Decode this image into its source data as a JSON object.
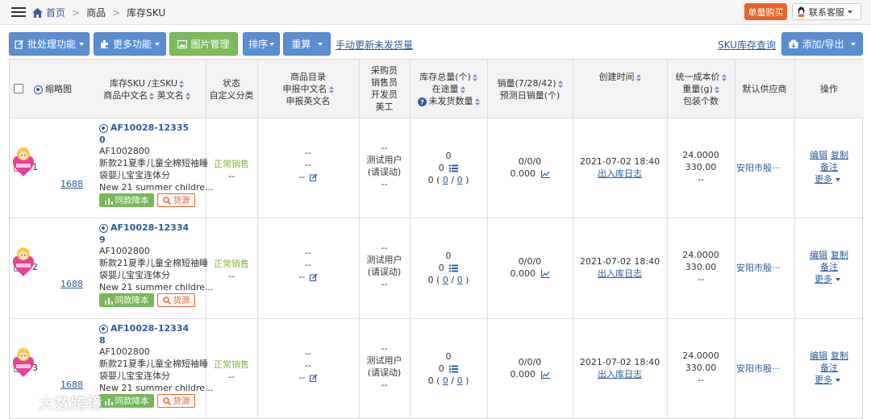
{
  "breadcrumb": {
    "home": "首页",
    "level2": "商品",
    "level3": "库存SKU"
  },
  "header": {
    "buy_button": "单量购买",
    "service_label": "联系客服"
  },
  "toolbar": {
    "batch": "批处理功能",
    "more": "更多功能",
    "image_manage": "图片管理",
    "sort": "排序",
    "recalc": "重算",
    "manual_update": "手动更新未发货量",
    "sku_query": "SKU库存查询",
    "add_export": "添加/导出"
  },
  "columns": {
    "thumb": "缩略图",
    "sku_l1": "库存SKU /主SKU",
    "sku_l2": "商品中文名",
    "sku_l3": "英文名",
    "status_l1": "状态",
    "status_l2": "自定义分类",
    "catalog_l1": "商品目录",
    "catalog_l2": "申报中文名",
    "catalog_l3": "申报英文名",
    "staff_l1": "采购员",
    "staff_l2": "销售员",
    "staff_l3": "开发员",
    "staff_l4": "美工",
    "stock_l1": "库存总量(个)",
    "stock_l2": "在途量",
    "stock_l3": "未发货数量",
    "sales_l1": "销量(7/28/42)",
    "sales_l2": "预测日销量(个)",
    "created": "创建时间",
    "cost_l1": "统一成本价",
    "cost_l2": "重量(g)",
    "cost_l3": "包装个数",
    "supplier": "默认供应商",
    "ops": "操作"
  },
  "rows": [
    {
      "index": "1",
      "sku_a": "AF10028-12335",
      "sku_b": "0",
      "main_sku": "AF1002800",
      "name_cn_1": "新款21夏季儿童全棉短袖睡",
      "name_cn_2": "袋婴儿宝宝连体分",
      "name_en": "New 21 summer childre...",
      "thumb_link": "1688",
      "status": "正常销售",
      "category": "--",
      "catalog": "--",
      "declare_cn": "--",
      "declare_en": "--",
      "buyer": "--",
      "seller_1": "测试用户",
      "seller_2": "(请误动)",
      "dev": "--",
      "stock": "0",
      "in_transit": "0",
      "unshipped_a": "0",
      "unshipped_b": "0",
      "unshipped_c": "0",
      "sales": "0/0/0",
      "forecast": "0.000",
      "created": "2021-07-02 18:40",
      "log_link": "出入库日志",
      "cost": "24.0000",
      "weight": "330.00",
      "pack": "--",
      "supplier": "安阳市殷···",
      "op_edit": "编辑",
      "op_copy": "复制",
      "op_note": "备注",
      "op_more": "更多"
    },
    {
      "index": "2",
      "sku_a": "AF10028-12334",
      "sku_b": "9",
      "main_sku": "AF1002800",
      "name_cn_1": "新款21夏季儿童全棉短袖睡",
      "name_cn_2": "袋婴儿宝宝连体分",
      "name_en": "New 21 summer childre...",
      "thumb_link": "1688",
      "status": "正常销售",
      "category": "--",
      "catalog": "--",
      "declare_cn": "--",
      "declare_en": "--",
      "buyer": "--",
      "seller_1": "测试用户",
      "seller_2": "(请误动)",
      "dev": "--",
      "stock": "0",
      "in_transit": "0",
      "unshipped_a": "0",
      "unshipped_b": "0",
      "unshipped_c": "0",
      "sales": "0/0/0",
      "forecast": "0.000",
      "created": "2021-07-02 18:40",
      "log_link": "出入库日志",
      "cost": "24.0000",
      "weight": "330.00",
      "pack": "--",
      "supplier": "安阳市殷···",
      "op_edit": "编辑",
      "op_copy": "复制",
      "op_note": "备注",
      "op_more": "更多"
    },
    {
      "index": "3",
      "sku_a": "AF10028-12334",
      "sku_b": "8",
      "main_sku": "AF1002800",
      "name_cn_1": "新款21夏季儿童全棉短袖睡",
      "name_cn_2": "袋婴儿宝宝连体分",
      "name_en": "New 21 summer childre...",
      "thumb_link": "1688",
      "status": "正常销售",
      "category": "--",
      "catalog": "--",
      "declare_cn": "--",
      "declare_en": "--",
      "buyer": "--",
      "seller_1": "测试用户",
      "seller_2": "(请误动)",
      "dev": "--",
      "stock": "0",
      "in_transit": "0",
      "unshipped_a": "0",
      "unshipped_b": "0",
      "unshipped_c": "0",
      "sales": "0/0/0",
      "forecast": "0.000",
      "created": "2021-07-02 18:40",
      "log_link": "出入库日志",
      "cost": "24.0000",
      "weight": "330.00",
      "pack": "--",
      "supplier": "安阳市殷···",
      "op_edit": "编辑",
      "op_copy": "复制",
      "op_note": "备注",
      "op_more": "更多"
    }
  ],
  "badges": {
    "price_down": "同款降本",
    "source": "货源"
  },
  "watermark": "大数跨境",
  "colors": {
    "accent_blue": "#5b8ed0",
    "green": "#7bbb5c",
    "orange": "#e8622a",
    "link": "#2b5c9c"
  }
}
